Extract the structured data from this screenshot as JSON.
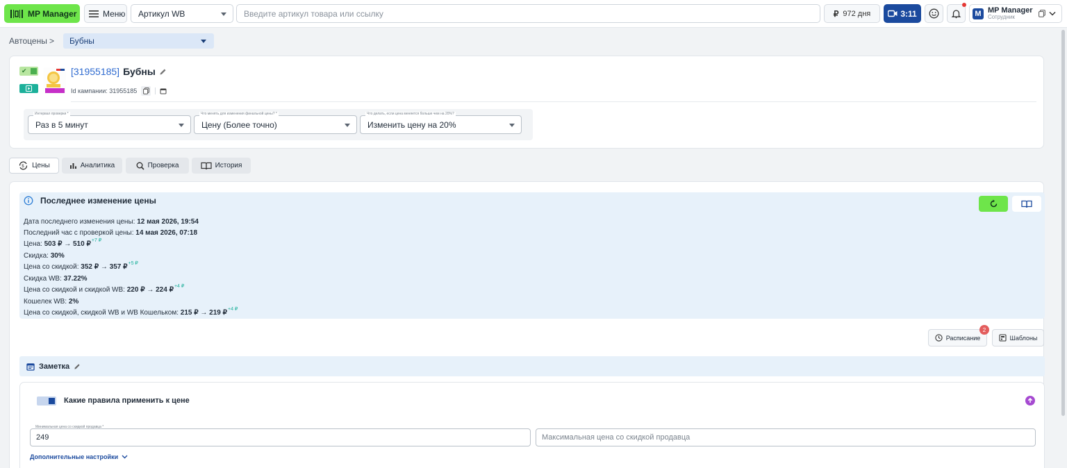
{
  "topbar": {
    "brand": "MP Manager",
    "menu_label": "Меню",
    "search_type": "Артикул WB",
    "search_placeholder": "Введите артикул товара или ссылку",
    "days": "972 дня",
    "video_time": "3:11",
    "user_name": "MP Manager",
    "user_role": "Сотрудник",
    "user_initial": "M"
  },
  "breadcrumb": {
    "root": "Автоцены",
    "separator": ">",
    "current": "Бубны"
  },
  "product": {
    "sku": "[31955185]",
    "name": "Бубны",
    "campaign_label": "Id кампании: 31955185"
  },
  "settings": [
    {
      "label": "Интервал проверки *",
      "value": "Раз в 5 минут"
    },
    {
      "label": "Что менять для изменения финальной цены? *",
      "value": "Цену (Более точно)"
    },
    {
      "label": "Что делать, если цена меняется больше чем на 20%?",
      "value": "Изменить цену на 20%"
    }
  ],
  "tabs": [
    {
      "label": "Цены",
      "icon": "price-cycle-icon"
    },
    {
      "label": "Аналитика",
      "icon": "bar-chart-icon"
    },
    {
      "label": "Проверка",
      "icon": "search-icon"
    },
    {
      "label": "История",
      "icon": "book-icon"
    }
  ],
  "last_change": {
    "title": "Последнее изменение цены",
    "rows": [
      {
        "label": "Дата последнего изменения цены: ",
        "value": "12 мая 2026, 19:54",
        "delta": ""
      },
      {
        "label": "Последний час с проверкой цены: ",
        "value": "14 мая 2026, 07:18",
        "delta": ""
      },
      {
        "label": "Цена: ",
        "value": "503 ₽ → 510 ₽",
        "delta": "+7 ₽"
      },
      {
        "label": "Скидка: ",
        "value": "30%",
        "delta": ""
      },
      {
        "label": "Цена со скидкой: ",
        "value": "352 ₽ → 357 ₽",
        "delta": "+5 ₽"
      },
      {
        "label": "Скидка WB: ",
        "value": "37.22%",
        "delta": ""
      },
      {
        "label": "Цена со скидкой и скидкой WB: ",
        "value": "220 ₽ → 224 ₽",
        "delta": "+4 ₽"
      },
      {
        "label": "Кошелек WB: ",
        "value": "2%",
        "delta": ""
      },
      {
        "label": "Цена со скидкой, скидкой WB и WB Кошельком: ",
        "value": "215 ₽ → 219 ₽",
        "delta": "+4 ₽"
      }
    ]
  },
  "actions": {
    "schedule": "Расписание",
    "schedule_badge": "2",
    "templates": "Шаблоны"
  },
  "note": {
    "label": "Заметка"
  },
  "rules": {
    "title": "Какие правила применить к цене",
    "min_label": "Минимальная цена со скидкой продавца *",
    "min_value": "249",
    "max_placeholder": "Максимальная цена со скидкой продавца",
    "more": "Дополнительные настройки"
  },
  "colors": {
    "accent_green": "#6ee54a",
    "brand_blue": "#1b4a9e",
    "info_bg": "#e7f1fa",
    "delta_green": "#1cb09a"
  }
}
